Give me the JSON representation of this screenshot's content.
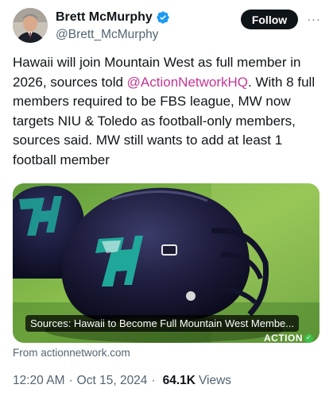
{
  "author": {
    "display_name": "Brett McMurphy",
    "handle": "@Brett_McMurphy",
    "verified": true,
    "verified_icon": "verified-badge-icon",
    "avatar_icon": "avatar"
  },
  "actions": {
    "follow_label": "Follow",
    "more_label": "···"
  },
  "tweet": {
    "text_before": "Hawaii will join Mountain West as full member in 2026, sources told ",
    "mention": "@ActionNetworkHQ",
    "text_after": ". With 8 full members required to be FBS league, MW now targets NIU & Toledo as football-only members, sources said. MW still wants to add at least 1 football member"
  },
  "link_card": {
    "title": "Sources: Hawaii to Become Full Mountain West Membe...",
    "brand": "ACTION",
    "brand_badge": "✓",
    "source": "From actionnetwork.com"
  },
  "meta": {
    "time": "12:20 AM",
    "separator_1": "·",
    "date": "Oct 15, 2024",
    "separator_2": "·",
    "views_count": "64.1K",
    "views_label": "Views"
  },
  "colors": {
    "mention": "#c63594",
    "secondary_text": "#536471",
    "primary_text": "#0f1419",
    "verified": "#1d9bf0",
    "helmet_logo": "#1fa89a"
  }
}
